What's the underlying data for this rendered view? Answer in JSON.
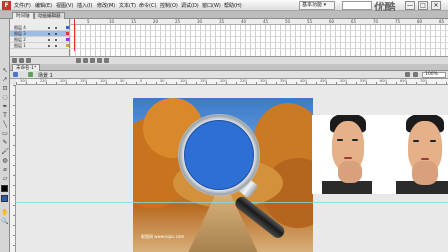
{
  "app": {
    "icon_letter": "F",
    "menu": [
      "文件(F)",
      "编辑(E)",
      "视图(V)",
      "插入(I)",
      "修改(M)",
      "文本(T)",
      "命令(C)",
      "控制(O)",
      "调试(D)",
      "窗口(W)",
      "帮助(H)"
    ],
    "workspace": "基本功能 ▾",
    "watermark": "优酷",
    "window_buttons": [
      "—",
      "□",
      "✕"
    ]
  },
  "timeline": {
    "tabs": [
      "时间轴",
      "动画编辑器"
    ],
    "frame_numbers": [
      "5",
      "10",
      "15",
      "20",
      "25",
      "30",
      "35",
      "40",
      "45",
      "50",
      "55",
      "60",
      "65",
      "70",
      "75",
      "80",
      "85"
    ],
    "layers": [
      {
        "name": "图层 4",
        "color": "#2f63d6"
      },
      {
        "name": "图层 3",
        "color": "#d63a3a"
      },
      {
        "name": "图层 2",
        "color": "#7a3ad6"
      },
      {
        "name": "图层 1",
        "color": "#d6a23a"
      }
    ]
  },
  "stage": {
    "doc_tab": "未命名-1*",
    "scene": "场景 1",
    "zoom": "100%",
    "ruler": [
      "300",
      "250",
      "200",
      "150",
      "100",
      "50",
      "0",
      "50",
      "100",
      "150",
      "200",
      "250",
      "300",
      "350",
      "400",
      "450",
      "500",
      "550",
      "600",
      "650",
      "700"
    ],
    "photo_caption": "昵图网 www.nipic.com"
  },
  "colors": {
    "lens": "#2e6fd6",
    "accent": "#e03030"
  }
}
